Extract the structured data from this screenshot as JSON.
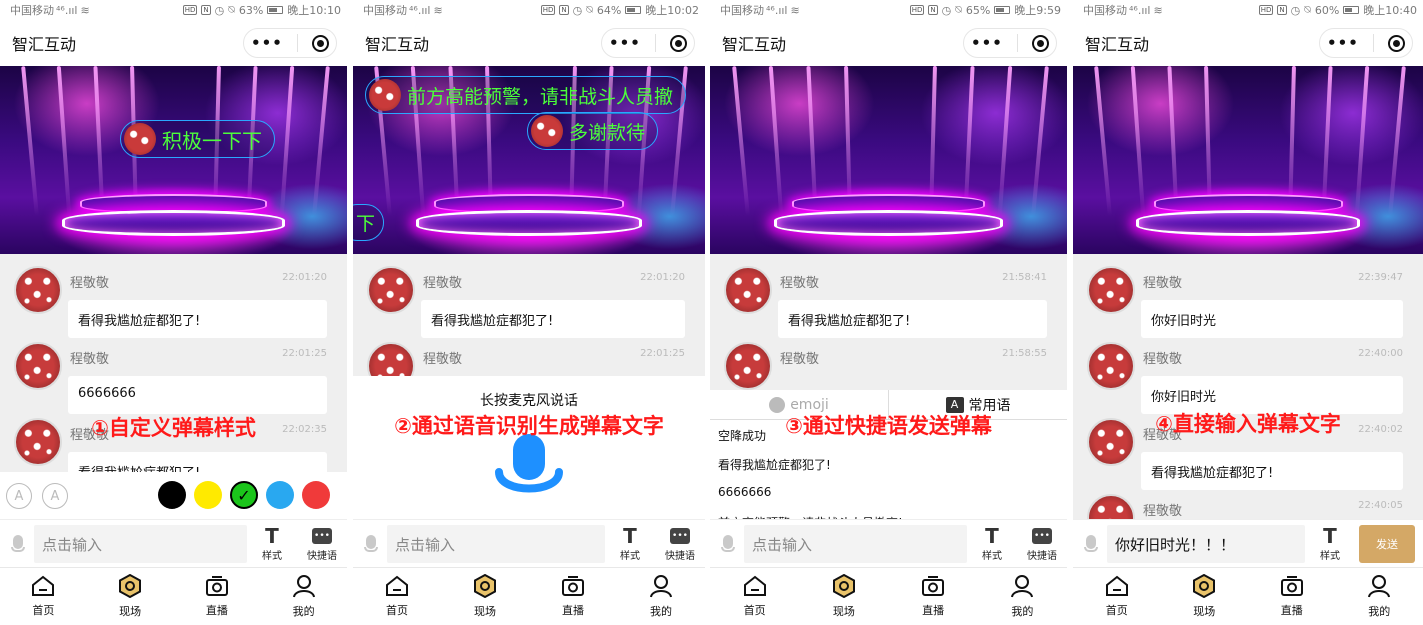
{
  "app_title": "智汇互动",
  "capsule": {
    "more_icon": "more-dots-icon",
    "close_icon": "target-circle-icon"
  },
  "colors": {
    "accent_red": "#ff1a1a",
    "danmu_green": "#4cff3a",
    "send_button": "#d4a866",
    "mic_blue": "#1e90ff"
  },
  "common": {
    "input_placeholder": "点击输入",
    "style_label": "样式",
    "quick_label": "快捷语",
    "tabs": [
      "首页",
      "现场",
      "直播",
      "我的"
    ],
    "sender_name": "程敬敬"
  },
  "phones": [
    {
      "status": {
        "carrier": "中国移动",
        "signal": "⁴⁶.ııl",
        "battery": "63%",
        "time": "晚上10:10"
      },
      "danmu": [
        "积极一下下"
      ],
      "messages": [
        {
          "time": "22:01:20",
          "text": "看得我尴尬症都犯了!"
        },
        {
          "time": "22:01:25",
          "text": "6666666"
        },
        {
          "time": "22:02:35",
          "text": "看得我尴尬症都犯了!"
        }
      ],
      "caption": "①自定义弹幕样式",
      "size_small": "A",
      "size_large": "A"
    },
    {
      "status": {
        "carrier": "中国移动",
        "signal": "⁴⁶.ııl",
        "battery": "64%",
        "time": "晚上10:02"
      },
      "danmu": [
        "前方高能预警，请非战斗人员撤",
        "多谢款待",
        "下"
      ],
      "messages": [
        {
          "time": "22:01:20",
          "text": "看得我尴尬症都犯了!"
        },
        {
          "time": "22:01:25",
          "text": ""
        }
      ],
      "voice_hint": "长按麦克风说话",
      "caption": "②通过语音识别生成弹幕文字"
    },
    {
      "status": {
        "carrier": "中国移动",
        "signal": "⁴⁶.ııl",
        "battery": "65%",
        "time": "晚上9:59"
      },
      "messages": [
        {
          "time": "21:58:41",
          "text": "看得我尴尬症都犯了!"
        },
        {
          "time": "21:58:55",
          "text": ""
        }
      ],
      "quick_tabs": {
        "emoji": "emoji",
        "common": "常用语",
        "common_badge": "A"
      },
      "quick_list": [
        "空降成功",
        "看得我尴尬症都犯了!",
        "6666666",
        "前方高能预警，请非战斗人员撤离!"
      ],
      "caption": "③通过快捷语发送弹幕"
    },
    {
      "status": {
        "carrier": "中国移动",
        "signal": "⁴⁶.ııl",
        "battery": "60%",
        "time": "晚上10:40"
      },
      "messages": [
        {
          "time": "22:39:47",
          "text": "你好旧时光"
        },
        {
          "time": "22:40:00",
          "text": "你好旧时光"
        },
        {
          "time": "22:40:02",
          "text": "看得我尴尬症都犯了!"
        },
        {
          "time": "22:40:05",
          "text": ""
        }
      ],
      "input_value": "你好旧时光！！！",
      "send_label": "发送",
      "caption": "④直接输入弹幕文字"
    }
  ]
}
